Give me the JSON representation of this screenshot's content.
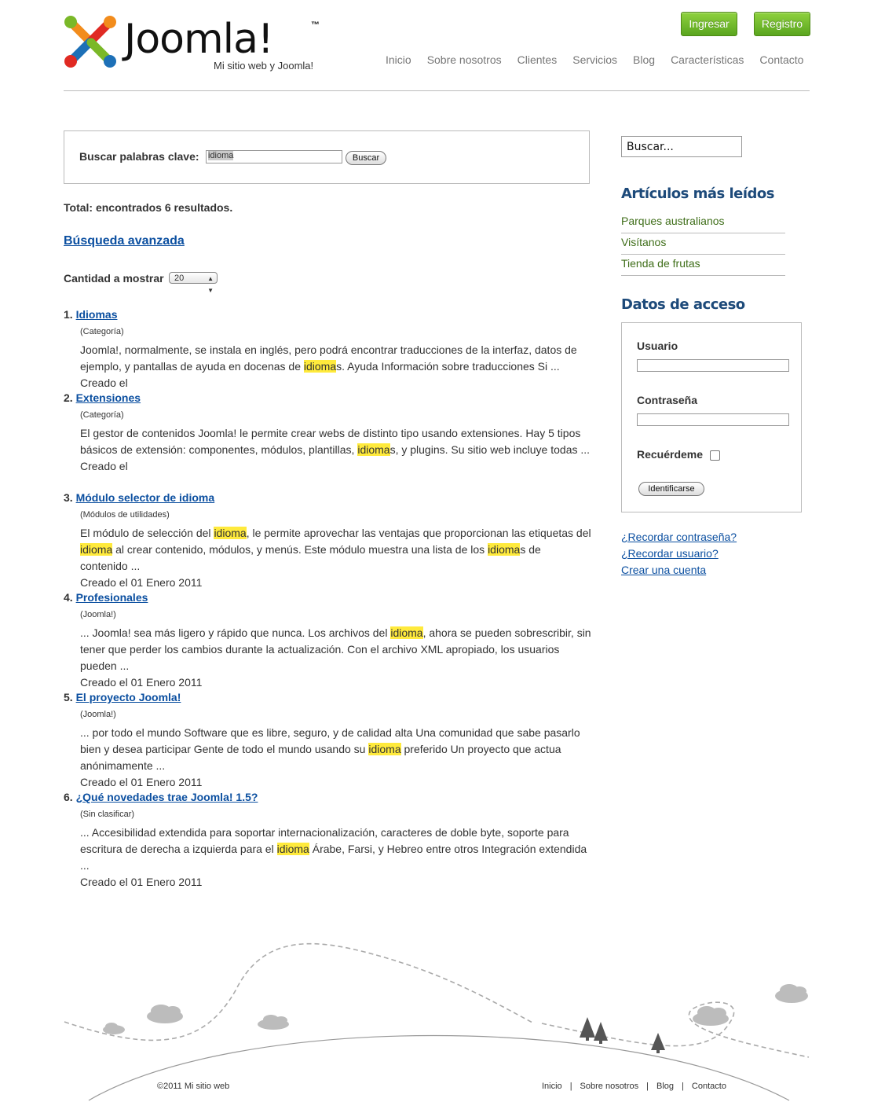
{
  "header": {
    "logo_text": "Joomla!",
    "logo_tm": "™",
    "tagline": "Mi sitio web y Joomla!",
    "ingresar_label": "Ingresar",
    "registro_label": "Registro",
    "nav": [
      "Inicio",
      "Sobre nosotros",
      "Clientes",
      "Servicios",
      "Blog",
      "Características",
      "Contacto"
    ]
  },
  "search": {
    "label": "Buscar palabras clave:",
    "value": "idioma",
    "button_label": "Buscar",
    "total_text": "Total: encontrados 6 resultados.",
    "advanced_link": "Búsqueda avanzada",
    "limit_label": "Cantidad a mostrar",
    "limit_value": "20"
  },
  "results": [
    {
      "num": "1.",
      "title": "Idiomas",
      "category": "(Categoría)",
      "text": [
        "Joomla!, normalmente, se instala en inglés, pero podrá encontrar traducciones de la interfaz, datos de ejemplo, y pantallas de ayuda en docenas de ",
        "idioma",
        "s. Ayuda Información sobre traducciones Si ..."
      ],
      "date": "Creado el"
    },
    {
      "num": "2.",
      "title": "Extensiones",
      "category": "(Categoría)",
      "text": [
        "El gestor de contenidos Joomla! le permite crear webs de distinto tipo usando extensiones. Hay 5 tipos básicos de extensión: componentes, módulos, plantillas, ",
        "idioma",
        "s, y plugins. Su sitio web incluye todas ..."
      ],
      "date": "Creado el"
    },
    {
      "num": "3.",
      "title": "Módulo selector de idioma",
      "category": "(Módulos de utilidades)",
      "text": [
        "El módulo de selección del ",
        "idioma",
        ", le permite aprovechar las ventajas que proporcionan las etiquetas del ",
        "idioma",
        " al crear contenido, módulos, y menús. Este módulo muestra una lista de los ",
        "idioma",
        "s de contenido ..."
      ],
      "date": "Creado el 01 Enero 2011"
    },
    {
      "num": "4.",
      "title": "Profesionales",
      "category": "(Joomla!)",
      "text": [
        "... Joomla! sea más ligero y rápido que nunca. Los archivos del ",
        "idioma",
        ", ahora se pueden sobrescribir, sin tener que perder los cambios durante la actualización. Con el archivo XML apropiado, los usuarios pueden ..."
      ],
      "date": "Creado el 01 Enero 2011"
    },
    {
      "num": "5.",
      "title": "El proyecto Joomla!",
      "category": "(Joomla!)",
      "text": [
        "... por todo el mundo Software que es libre, seguro, y de calidad alta Una comunidad que sabe pasarlo bien y desea participar Gente de todo el mundo usando su ",
        "idioma",
        " preferido Un proyecto que actua anónimamente ..."
      ],
      "date": "Creado el 01 Enero 2011"
    },
    {
      "num": "6.",
      "title": "¿Qué novedades trae Joomla! 1.5?",
      "category": "(Sin clasificar)",
      "text": [
        "...  Accesibilidad extendida para soportar internacionalización, caracteres de doble byte, soporte para escritura de derecha a izquierda para el ",
        "idioma",
        " Árabe, Farsi, y Hebreo entre otros Integración extendida ..."
      ],
      "date": "Creado el 01 Enero 2011"
    }
  ],
  "sidebar": {
    "search_placeholder": "Buscar...",
    "mostread_heading": "Artículos más leídos",
    "mostread_items": [
      "Parques australianos",
      "Visítanos",
      "Tienda de frutas"
    ],
    "login_heading": "Datos de acceso",
    "username_label": "Usuario",
    "password_label": "Contraseña",
    "remember_label": "Recuérdeme",
    "login_button": "Identificarse",
    "links": [
      "¿Recordar contraseña?",
      "¿Recordar usuario?",
      "Crear una cuenta"
    ]
  },
  "footer": {
    "copyright": "©2011 Mi sitio web",
    "nav": [
      "Inicio",
      "Sobre nosotros",
      "Blog",
      "Contacto"
    ]
  },
  "colors": {
    "accent_green": "#5aa51f",
    "link_blue": "#0b4fa0",
    "heading_blue": "#1d4a7a",
    "highlight": "#ffea3c",
    "sidebar_link_green": "#3f6e19"
  }
}
